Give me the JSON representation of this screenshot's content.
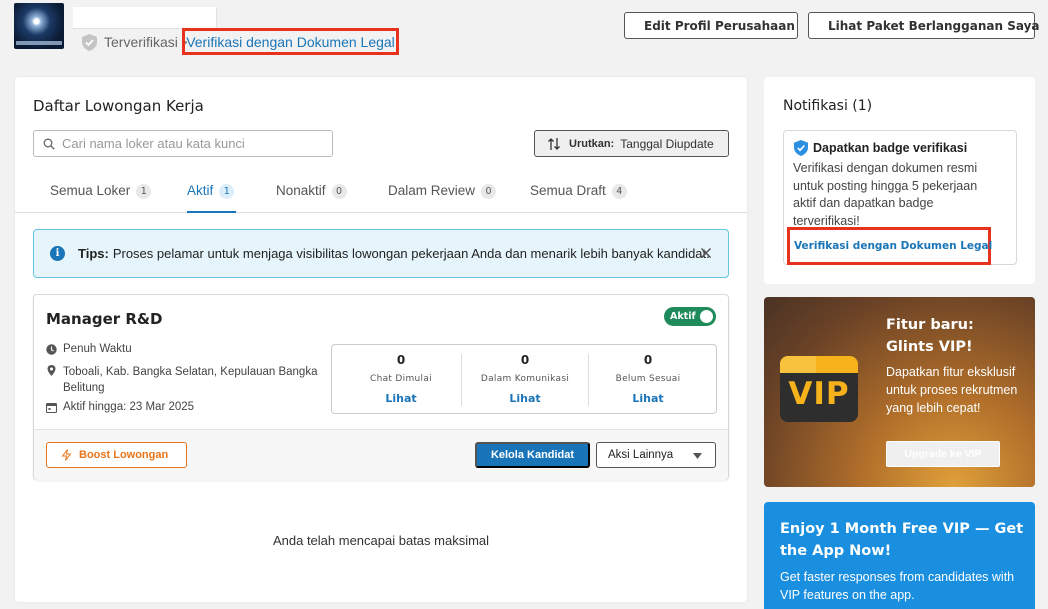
{
  "header": {
    "verified_label": "Terverifikasi",
    "legal_link": "Verifikasi dengan Dokumen Legal",
    "edit_profile": "Edit Profil Perusahaan",
    "view_plan": "Lihat Paket Berlangganan Saya"
  },
  "main": {
    "title": "Daftar Lowongan Kerja",
    "search_placeholder": "Cari nama loker atau kata kunci",
    "sort_label": "Urutkan:",
    "sort_value": "Tanggal Diupdate",
    "tabs": [
      {
        "label": "Semua Loker",
        "count": "1"
      },
      {
        "label": "Aktif",
        "count": "1"
      },
      {
        "label": "Nonaktif",
        "count": "0"
      },
      {
        "label": "Dalam Review",
        "count": "0"
      },
      {
        "label": "Semua Draft",
        "count": "4"
      }
    ],
    "tips_bold": "Tips:",
    "tips_text": "Proses pelamar untuk menjaga visibilitas lowongan pekerjaan Anda dan menarik lebih banyak kandidat.",
    "job": {
      "title": "Manager R&D",
      "status": "Aktif",
      "type": "Penuh Waktu",
      "location": "Toboali, Kab. Bangka Selatan, Kepulauan Bangka Belitung",
      "active_until": "Aktif hingga: 23 Mar 2025",
      "stats": [
        {
          "value": "0",
          "label": "Chat Dimulai",
          "link": "Lihat"
        },
        {
          "value": "0",
          "label": "Dalam Komunikasi",
          "link": "Lihat"
        },
        {
          "value": "0",
          "label": "Belum Sesuai",
          "link": "Lihat"
        }
      ],
      "boost": "Boost Lowongan",
      "manage": "Kelola Kandidat",
      "more": "Aksi Lainnya"
    },
    "max_text": "Anda telah mencapai batas maksimal"
  },
  "notifications": {
    "title": "Notifikasi (1)",
    "card_title": "Dapatkan badge verifikasi",
    "card_body": "Verifikasi dengan dokumen resmi untuk posting hingga 5 pekerjaan aktif dan dapatkan badge terverifikasi!",
    "card_link": "Verifikasi dengan Dokumen Legal"
  },
  "vip": {
    "badge": "VIP",
    "title": "Fitur baru: Glints VIP!",
    "desc": "Dapatkan fitur eksklusif untuk proses rekrutmen yang lebih cepat!",
    "button": "Upgrade ke VIP"
  },
  "app_promo": {
    "title": "Enjoy 1 Month Free VIP — Get the App Now!",
    "desc": "Get faster responses from candidates with VIP features on the app."
  },
  "colors": {
    "brand_blue": "#1a75b8",
    "highlight_red": "#e8321e",
    "active_green": "#1f8a5a",
    "boost_orange": "#e8751a"
  }
}
